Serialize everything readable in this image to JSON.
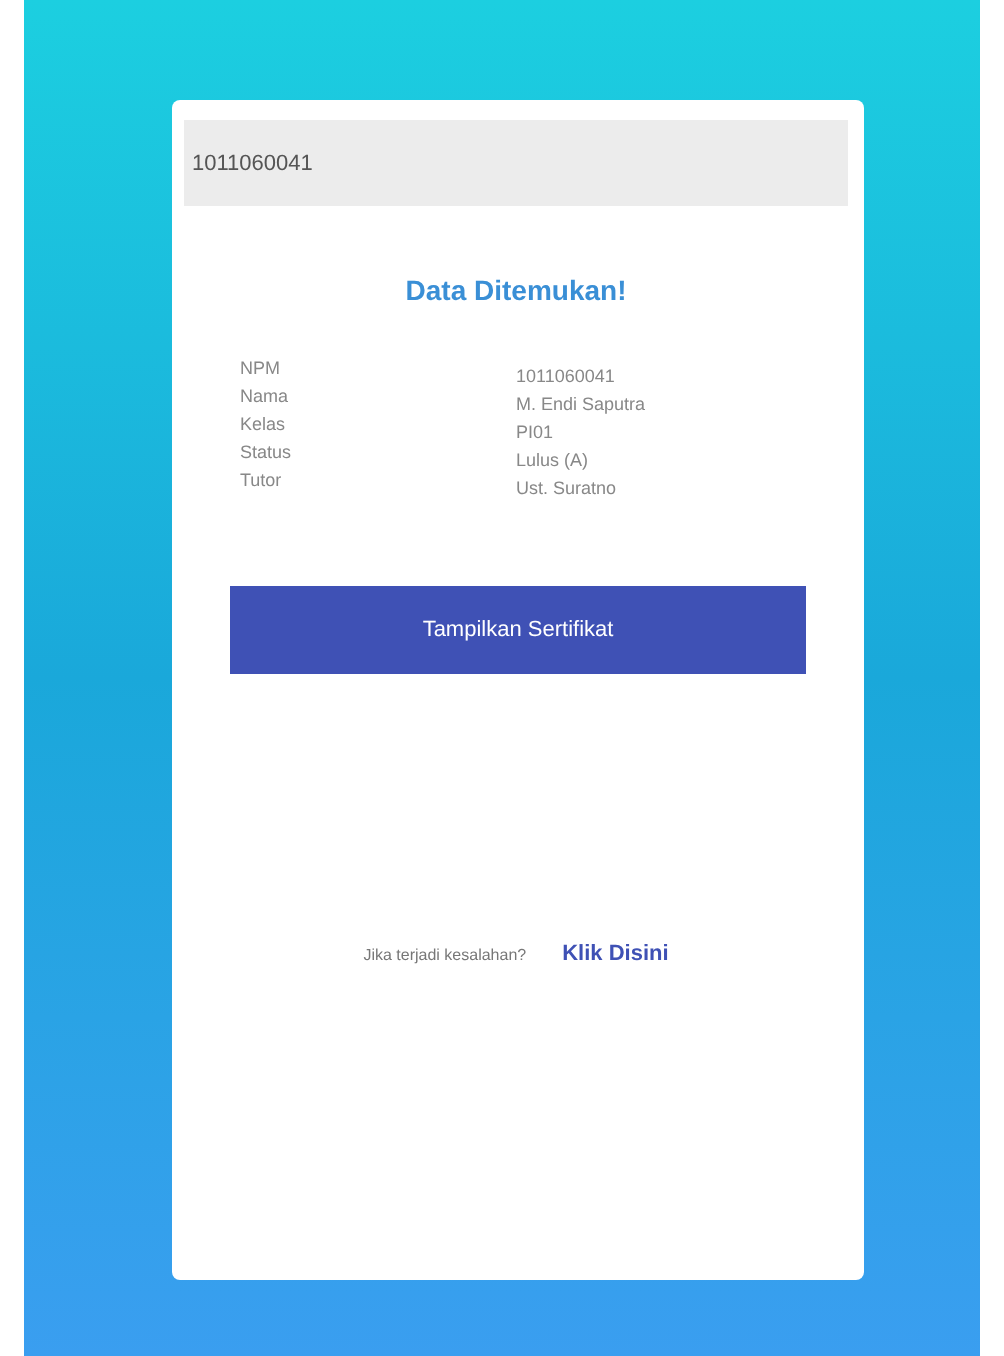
{
  "search": {
    "value": "1011060041"
  },
  "title": "Data Ditemukan!",
  "details": [
    {
      "label": "NPM",
      "value": "1011060041"
    },
    {
      "label": "Nama",
      "value": "M. Endi Saputra"
    },
    {
      "label": "Kelas",
      "value": "PI01"
    },
    {
      "label": "Status",
      "value": "Lulus (A)"
    },
    {
      "label": "Tutor",
      "value": "Ust. Suratno"
    }
  ],
  "button": "Tampilkan Sertifikat",
  "help": {
    "text": "Jika terjadi kesalahan?",
    "link": "Klik Disini"
  }
}
